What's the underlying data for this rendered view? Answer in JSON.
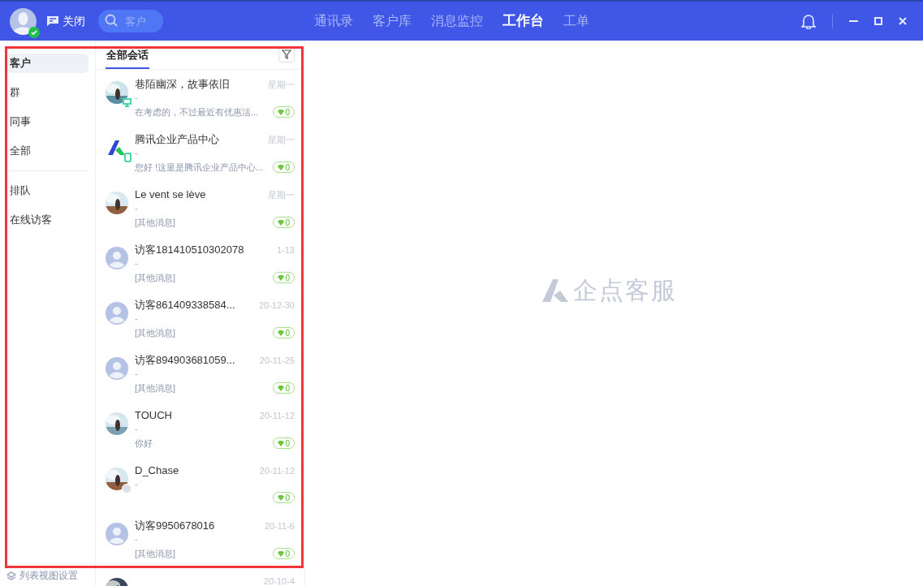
{
  "topbar": {
    "close_label": "关闭",
    "search": {
      "placeholder": "客户"
    },
    "tabs": [
      {
        "label": "通讯录",
        "selected": false
      },
      {
        "label": "客户库",
        "selected": false
      },
      {
        "label": "消息监控",
        "selected": false
      },
      {
        "label": "工作台",
        "selected": true
      },
      {
        "label": "工单",
        "selected": false
      }
    ]
  },
  "nav": {
    "groups": [
      [
        {
          "label": "客户",
          "selected": true
        },
        {
          "label": "群",
          "selected": false
        },
        {
          "label": "同事",
          "selected": false
        },
        {
          "label": "全部",
          "selected": false
        }
      ],
      [
        {
          "label": "排队",
          "selected": false
        },
        {
          "label": "在线访客",
          "selected": false
        }
      ]
    ],
    "footer": "列表视图设置"
  },
  "list": {
    "tab": "全部会话",
    "rows": [
      {
        "name": "巷陌幽深，故事依旧",
        "time": "星期一",
        "sub": "-",
        "preview": "在考虑的，不过最近有优惠活...",
        "count": "0",
        "device": {
          "kind": "pc"
        }
      },
      {
        "name": "腾讯企业产品中心",
        "time": "星期一",
        "sub": "-",
        "preview": "您好 !这里是腾讯企业产品中心...",
        "count": "0",
        "avatar": {
          "kind": "logo"
        },
        "device": {
          "kind": "mobile"
        }
      },
      {
        "name": "Le vent se lève",
        "time": "星期一",
        "sub": "-",
        "preview": "[其他消息]",
        "count": "0"
      },
      {
        "name": "访客181410510302078",
        "time": "1-13",
        "sub": "-",
        "preview": "[其他消息]",
        "count": "0",
        "avatar": {
          "kind": "default"
        }
      },
      {
        "name": "访客861409338584...",
        "time": "20-12-30",
        "sub": "-",
        "preview": "[其他消息]",
        "count": "0",
        "avatar": {
          "kind": "default"
        }
      },
      {
        "name": "访客894903681059...",
        "time": "20-11-25",
        "sub": "-",
        "preview": "[其他消息]",
        "count": "0",
        "avatar": {
          "kind": "default"
        }
      },
      {
        "name": "TOUCH",
        "time": "20-11-12",
        "sub": "-",
        "preview": "你好",
        "count": "0"
      },
      {
        "name": "D_Chase",
        "time": "20-11-12",
        "sub": "-",
        "count": "0",
        "device": {
          "kind": "offline"
        }
      },
      {
        "name": "访客9950678016",
        "time": "20-11-6",
        "sub": "-",
        "preview": "[其他消息]",
        "count": "0",
        "avatar": {
          "kind": "default"
        }
      },
      {
        "time": "20-10-4"
      }
    ]
  },
  "empty_logo": "企点客服"
}
